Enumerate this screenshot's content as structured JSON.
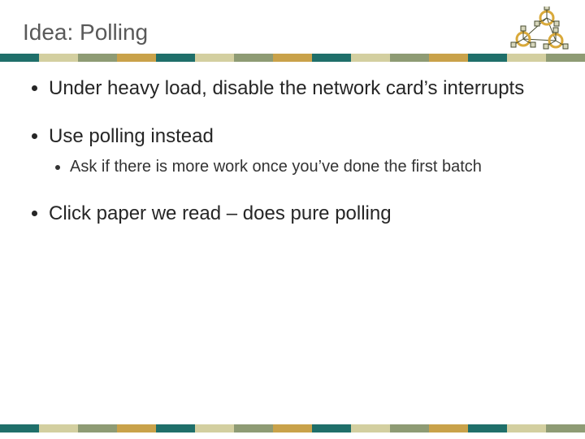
{
  "title": "Idea: Polling",
  "bullets": {
    "b1": "Under heavy load, disable the network card’s interrupts",
    "b2": "Use polling instead",
    "b2a": "Ask if there is more work once you’ve done the first batch",
    "b3": "Click paper we read – does pure polling"
  },
  "stripe_colors": [
    "#1f6f6a",
    "#d3cfa0",
    "#8e9b74",
    "#c9a24a",
    "#1f6f6a",
    "#d3cfa0",
    "#8e9b74",
    "#c9a24a",
    "#1f6f6a",
    "#d3cfa0",
    "#8e9b74",
    "#c9a24a",
    "#1f6f6a",
    "#d3cfa0",
    "#8e9b74"
  ],
  "logo_colors": {
    "ring": "#d9a93a",
    "box_stroke": "#474b2e",
    "box_fill": "#d7d7bd",
    "spoke": "#474b2e"
  }
}
